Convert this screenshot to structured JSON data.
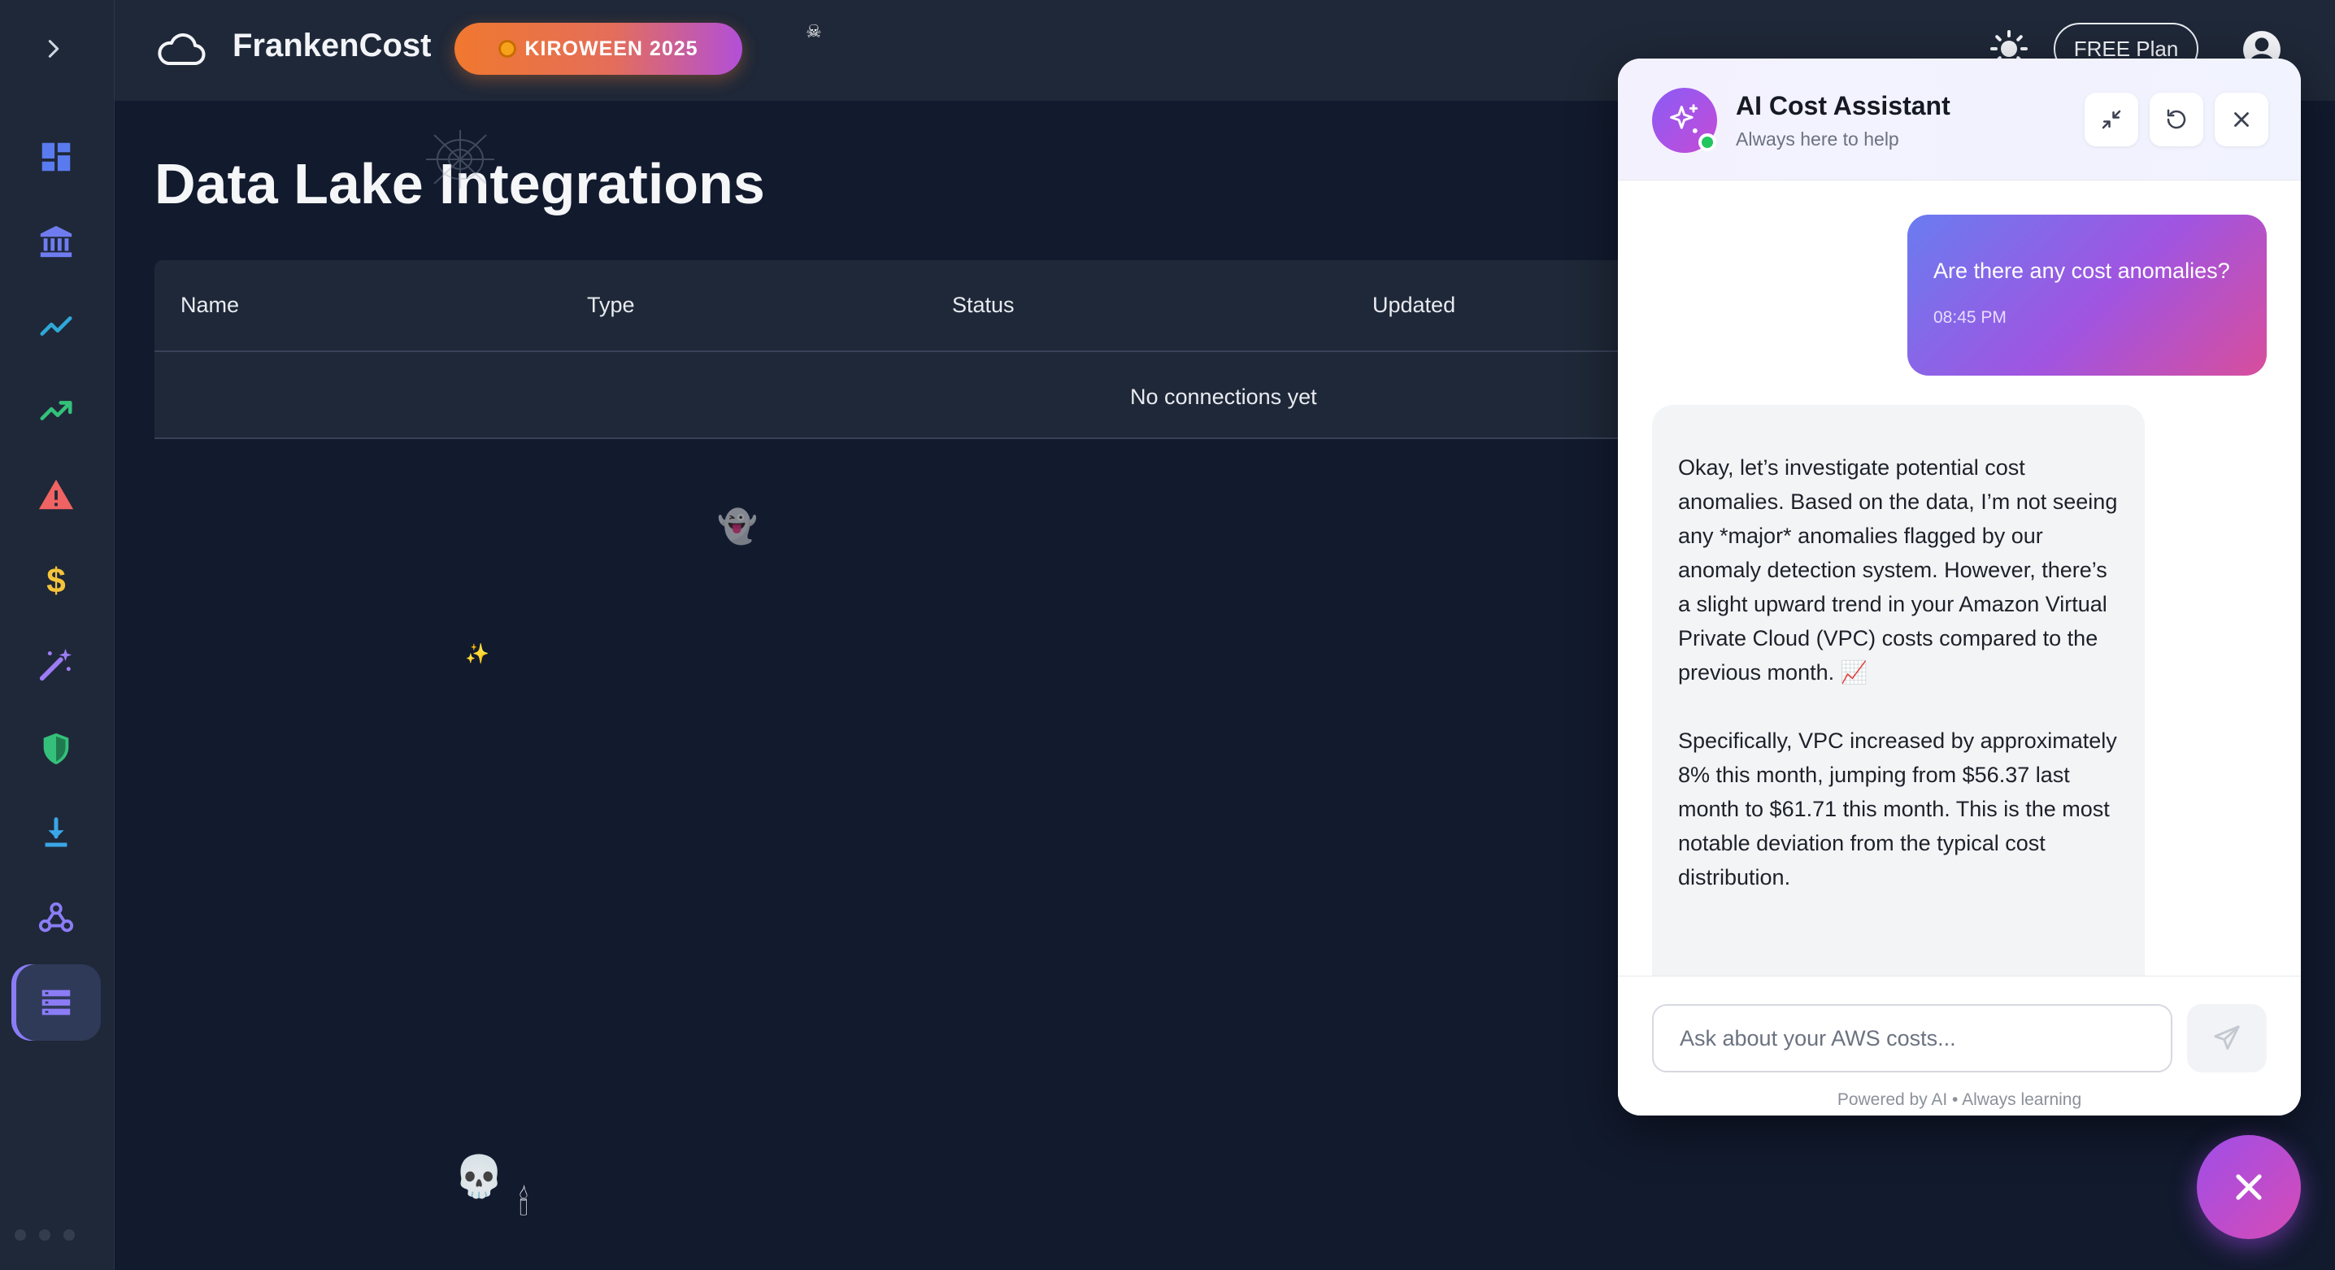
{
  "app": {
    "brand": "FrankenCost",
    "badge": "KIROWEEN 2025",
    "plan": "FREE Plan"
  },
  "sidebar": {
    "items": [
      {
        "name": "dashboard",
        "icon": "grid-icon",
        "color": "#5a7bf0"
      },
      {
        "name": "accounts",
        "icon": "bank-icon",
        "color": "#6f7cf0"
      },
      {
        "name": "trends",
        "icon": "line-chart-icon",
        "color": "#2fa8d8"
      },
      {
        "name": "forecast",
        "icon": "trending-up-icon",
        "color": "#34c07a"
      },
      {
        "name": "anomalies",
        "icon": "warning-icon",
        "color": "#f06363"
      },
      {
        "name": "costs",
        "icon": "dollar-icon",
        "color": "#f5c43a"
      },
      {
        "name": "optimize",
        "icon": "magic-wand-icon",
        "color": "#9d7cf6"
      },
      {
        "name": "security",
        "icon": "shield-icon",
        "color": "#34c07a"
      },
      {
        "name": "exports",
        "icon": "download-icon",
        "color": "#3aa6e8"
      },
      {
        "name": "webhooks",
        "icon": "webhook-icon",
        "color": "#8b7cf6"
      },
      {
        "name": "data-lake",
        "icon": "database-icon",
        "color": "#8b7cf6"
      }
    ],
    "active": "data-lake"
  },
  "page": {
    "title": "Data Lake Integrations",
    "table": {
      "columns": [
        "Name",
        "Type",
        "Status",
        "Updated"
      ],
      "empty_text": "No connections yet"
    }
  },
  "chat": {
    "title": "AI Cost Assistant",
    "subtitle": "Always here to help",
    "messages": [
      {
        "role": "user",
        "text": "Are there any cost anomalies?",
        "time": "08:45 PM"
      },
      {
        "role": "assistant",
        "paragraphs": [
          "Okay, let’s investigate potential cost anomalies. Based on the data, I’m not seeing any *major* anomalies flagged by our anomaly detection system. However, there’s a slight upward trend in your Amazon Virtual Private Cloud (VPC) costs compared to the previous month. 📈",
          "Specifically, VPC increased by approximately 8% this month, jumping from $56.37 last month to $61.71 this month. This is the most notable deviation from the typical cost distribution."
        ]
      }
    ],
    "input_placeholder": "Ask about your AWS costs...",
    "footer": "Powered by AI • Always learning"
  },
  "colors": {
    "accent": "#8b5cf6",
    "online": "#22c55e",
    "badge_start": "#f0782f",
    "badge_end": "#b24fd8"
  }
}
